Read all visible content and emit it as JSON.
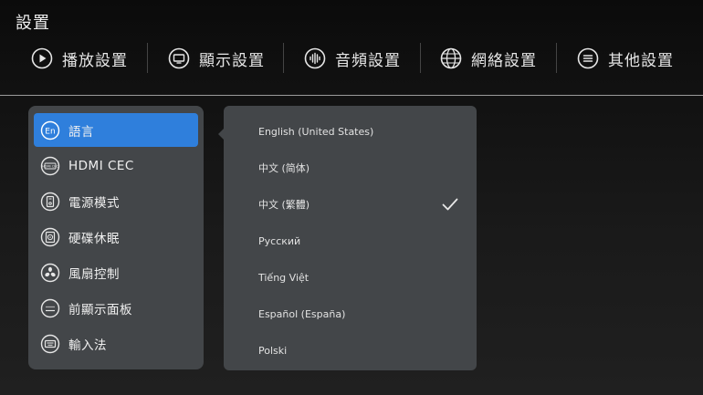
{
  "page": {
    "title": "設置"
  },
  "tabs": [
    {
      "label": "播放設置",
      "icon": "play-circle-icon"
    },
    {
      "label": "顯示設置",
      "icon": "display-icon"
    },
    {
      "label": "音頻設置",
      "icon": "audio-wave-icon"
    },
    {
      "label": "網絡設置",
      "icon": "globe-icon"
    },
    {
      "label": "其他設置",
      "icon": "list-menu-icon",
      "active": true
    }
  ],
  "menu": {
    "selected_index": 0,
    "items": [
      {
        "label": "語言",
        "icon": "language-en-icon",
        "icon_text": "En"
      },
      {
        "label": "HDMI CEC",
        "icon": "hdmi-cec-icon",
        "icon_text": "HDMI CEC"
      },
      {
        "label": "電源模式",
        "icon": "power-mode-icon"
      },
      {
        "label": "硬碟休眠",
        "icon": "hard-disk-icon"
      },
      {
        "label": "風扇控制",
        "icon": "fan-icon"
      },
      {
        "label": "前顯示面板",
        "icon": "front-panel-icon"
      },
      {
        "label": "輸入法",
        "icon": "keyboard-icon"
      }
    ]
  },
  "languages": {
    "selected_index": 2,
    "options": [
      "English (United States)",
      "中文 (简体)",
      "中文 (繁體)",
      "Русский",
      "Tiếng Việt",
      "Español (España)",
      "Polski"
    ]
  },
  "colors": {
    "accent": "#2f7fdc",
    "panel": "#434649",
    "background": "#141414"
  }
}
